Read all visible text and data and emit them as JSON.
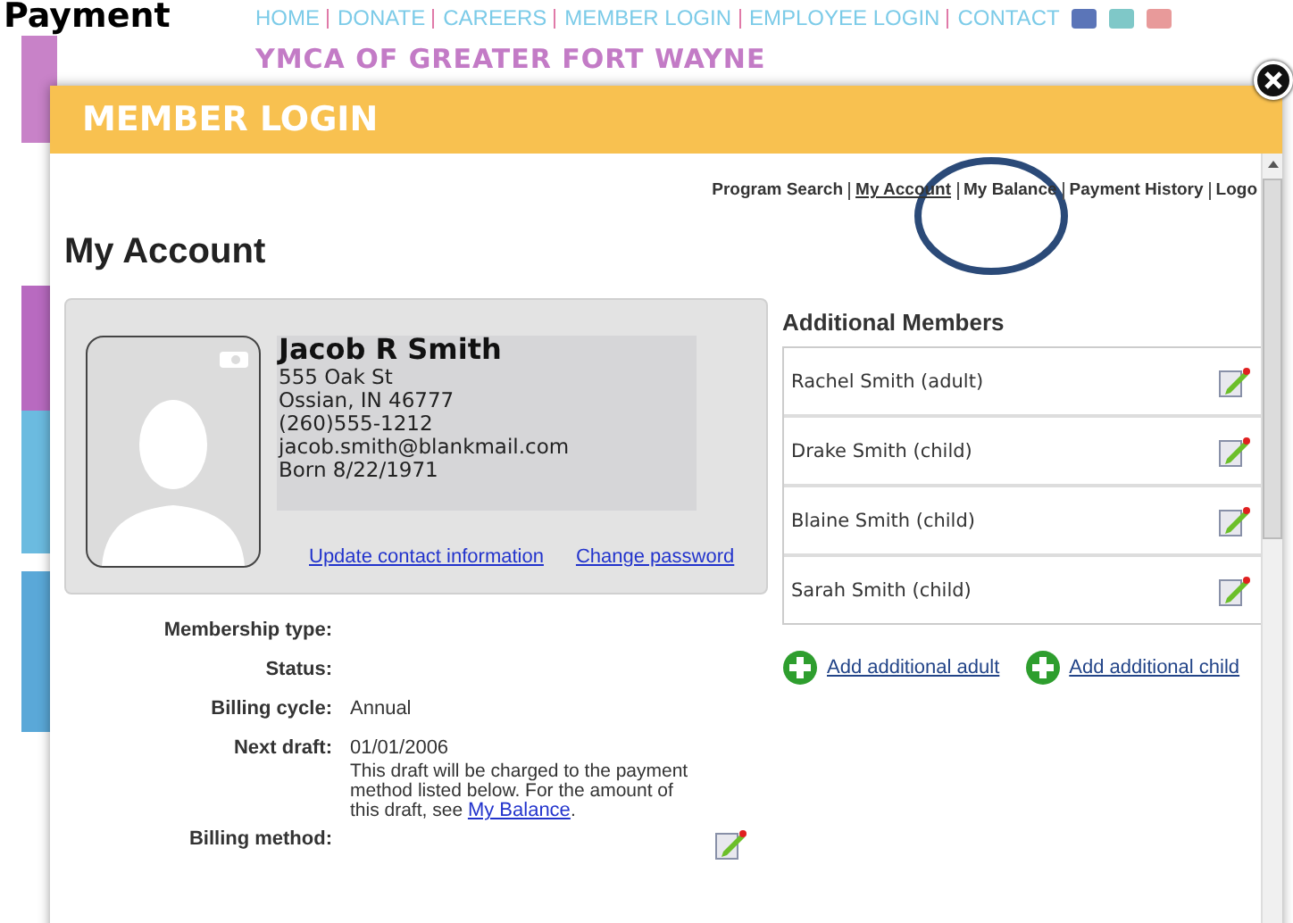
{
  "page_heading": "Payment",
  "site_nav": [
    "HOME",
    "DONATE",
    "CAREERS",
    "MEMBER LOGIN",
    "EMPLOYEE LOGIN",
    "CONTACT"
  ],
  "site_title": "YMCA OF GREATER FORT WAYNE",
  "modal": {
    "title": "MEMBER LOGIN",
    "account_links": [
      {
        "label": "Program Search",
        "selected": false
      },
      {
        "label": "My Account",
        "selected": true
      },
      {
        "label": "My Balance",
        "selected": false,
        "circled": true
      },
      {
        "label": "Payment History",
        "selected": false
      },
      {
        "label": "Logo",
        "selected": false
      }
    ],
    "heading": "My Account",
    "profile": {
      "name": "Jacob R Smith",
      "lines": [
        "555 Oak St",
        "Ossian, IN 46777",
        "(260)555-1212",
        "jacob.smith@blankmail.com",
        "Born 8/22/1971"
      ],
      "links": [
        "Update contact information",
        "Change password"
      ]
    },
    "additional_members": {
      "title": "Additional Members",
      "members": [
        "Rachel Smith (adult)",
        "Drake Smith (child)",
        "Blaine Smith (child)",
        "Sarah Smith (child)"
      ],
      "actions": [
        "Add additional adult",
        "Add additional child"
      ]
    },
    "details": [
      {
        "label": "Membership type:"
      },
      {
        "label": "Status:"
      },
      {
        "label": "Billing cycle:",
        "value": "Annual"
      },
      {
        "label": "Next draft:",
        "value": "01/01/2006",
        "note": "This draft will be charged to the payment method listed below. For the amount of this draft, see ",
        "note_link": "My Balance",
        "note_end": "."
      },
      {
        "label": "Billing method:",
        "editable": true
      }
    ]
  }
}
